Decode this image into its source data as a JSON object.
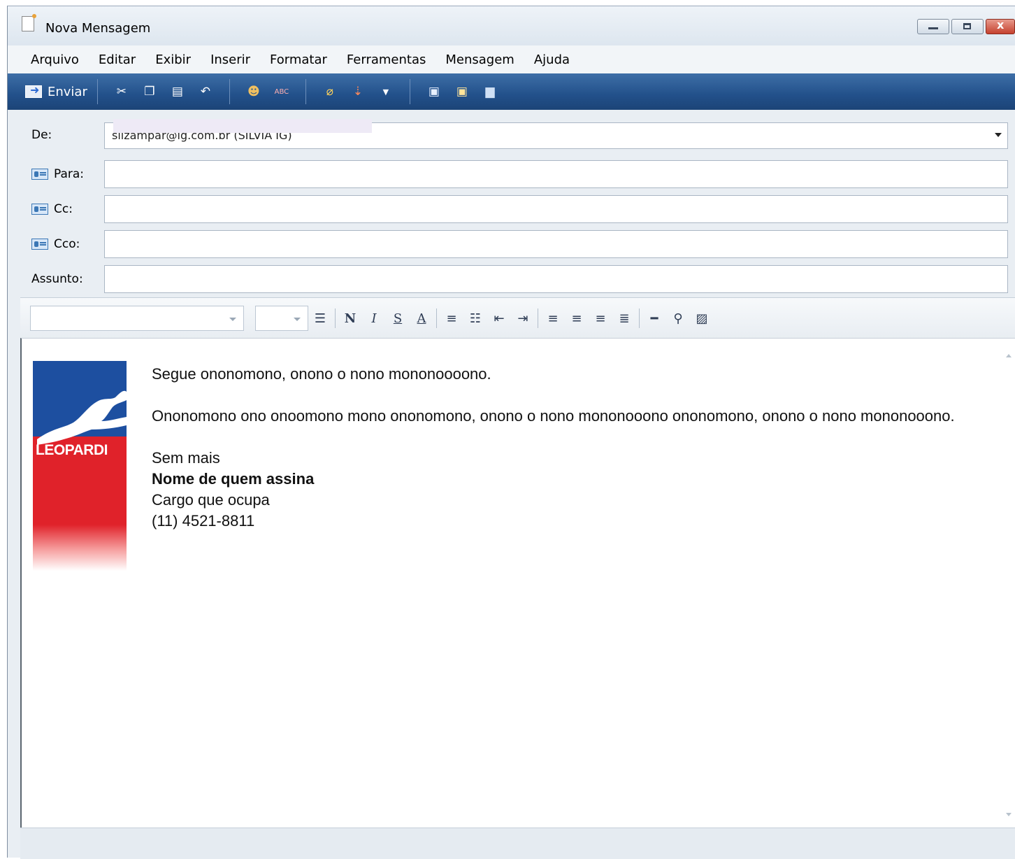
{
  "window": {
    "title": "Nova Mensagem"
  },
  "menu": [
    "Arquivo",
    "Editar",
    "Exibir",
    "Inserir",
    "Formatar",
    "Ferramentas",
    "Mensagem",
    "Ajuda"
  ],
  "toolbar": {
    "send_label": "Enviar",
    "icons": [
      "cut-icon",
      "copy-icon",
      "paste-icon",
      "undo-icon",
      "check-names-icon",
      "spelling-icon",
      "attach-icon",
      "priority-icon",
      "priority-dropdown-icon",
      "sign-icon",
      "encrypt-icon",
      "work-offline-icon"
    ],
    "spell_label": "ABC"
  },
  "fields": {
    "from_label": "De:",
    "from_value": "silzampar@ig.com.br    (SILVIA IG)",
    "to_label": "Para:",
    "cc_label": "Cc:",
    "bcc_label": "Cco:",
    "subject_label": "Assunto:"
  },
  "format": {
    "bold": "N",
    "italic": "I",
    "underline": "S",
    "color": "A"
  },
  "body": {
    "line1": "Segue ononomono, onono o nono mononoooono.",
    "line2": "Ononomono ono onoomono mono ononomono, onono o nono mononooono ononomono, onono o nono mononooono.",
    "closing": "Sem mais",
    "signer_name": "Nome de quem assina",
    "signer_role": "Cargo que ocupa",
    "signer_phone": "(11) 4521-8811"
  },
  "logo": {
    "text": "LEOPARDI",
    "colors": {
      "blue": "#1d4fa0",
      "red": "#e0222a"
    }
  }
}
